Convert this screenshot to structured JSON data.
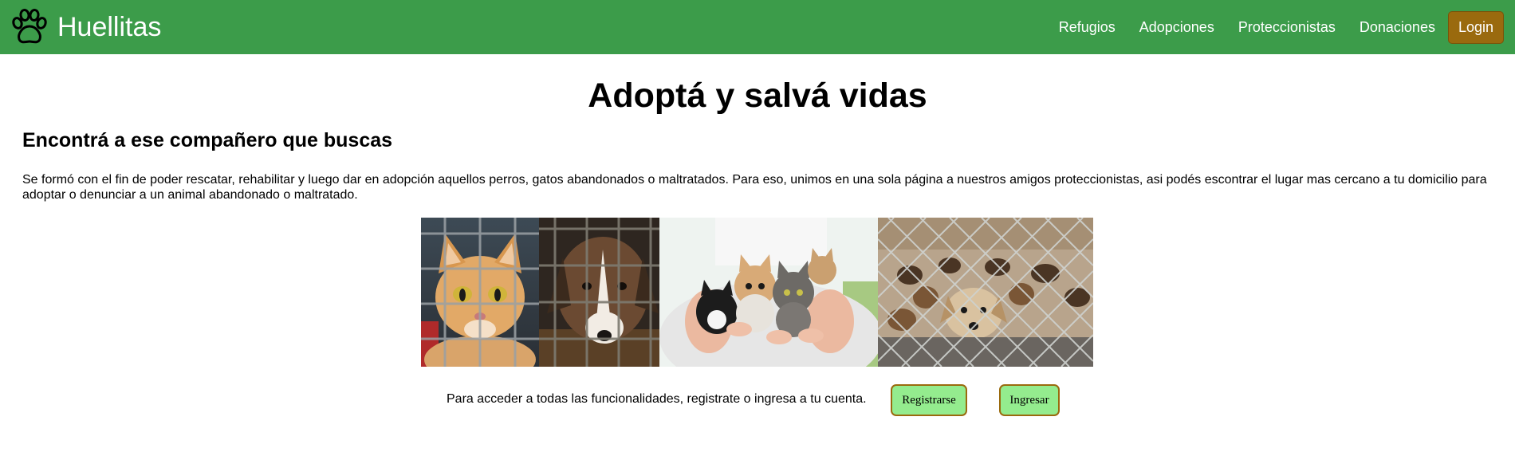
{
  "navbar": {
    "brand": "Huellitas",
    "links": [
      "Refugios",
      "Adopciones",
      "Proteccionistas",
      "Donaciones"
    ],
    "login_label": "Login",
    "background_color": "#3c9c4a",
    "login_color": "#9a6a0e",
    "brand_icon": "paw-icon"
  },
  "hero": {
    "title": "Adoptá y salvá vidas",
    "subtitle": "Encontrá a ese compañero que buscas",
    "description": "Se formó con el fin de poder rescatar, rehabilitar y luego dar en adopción aquellos perros, gatos abandonados o maltratados. Para eso, unimos en una sola página a nuestros amigos proteccionistas, asi podés escontrar el lugar mas cercano a tu domicilio para adoptar o denunciar a un animal abandonado o maltratado."
  },
  "collage": {
    "images": [
      "cat-behind-cage-photo",
      "dog-behind-cage-photo",
      "kittens-in-hands-photo",
      "dogs-behind-fence-photo"
    ]
  },
  "cta": {
    "text": "Para acceder a todas las funcionalidades, registrate o ingresa a tu cuenta.",
    "register_label": "Registrarse",
    "signin_label": "Ingresar",
    "button_color": "#94ec8e"
  }
}
